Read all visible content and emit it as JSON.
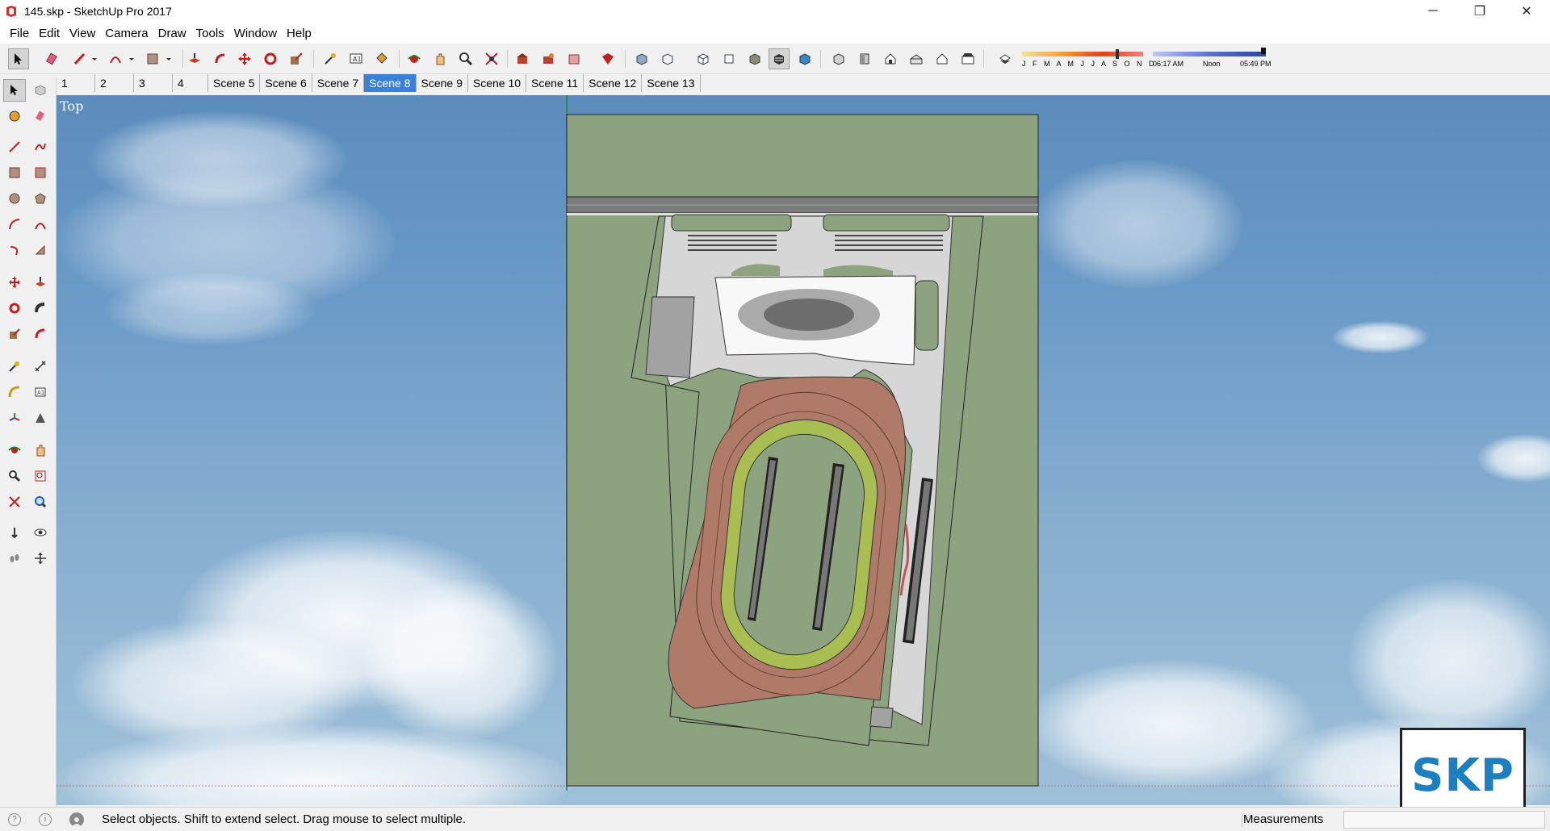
{
  "window": {
    "title": "145.skp - SketchUp Pro 2017",
    "minimize": "─",
    "restore": "❐",
    "close": "✕"
  },
  "menu": [
    "File",
    "Edit",
    "View",
    "Camera",
    "Draw",
    "Tools",
    "Window",
    "Help"
  ],
  "shadow_settings": {
    "months": "J F M A M J J A S O N D",
    "time_start": "06:17 AM",
    "time_mid": "Noon",
    "time_end": "05:49 PM"
  },
  "scenes": {
    "tabs": [
      "1",
      "2",
      "3",
      "4",
      "Scene 5",
      "Scene 6",
      "Scene 7",
      "Scene 8",
      "Scene 9",
      "Scene 10",
      "Scene 11",
      "Scene 12",
      "Scene 13"
    ],
    "active": "Scene 8"
  },
  "viewport": {
    "view_name": "Top"
  },
  "status": {
    "hint": "Select objects. Shift to extend select. Drag mouse to select multiple.",
    "measurements_label": "Measurements",
    "measurements_value": ""
  },
  "logo": {
    "text": "SKP"
  },
  "colors": {
    "ground": "#8da37f",
    "road": "#7d7d7d",
    "pavement": "#d6d6d6",
    "track": "#b07a68",
    "infield_ring": "#a8bd52",
    "active_tab": "#3a80d9"
  }
}
